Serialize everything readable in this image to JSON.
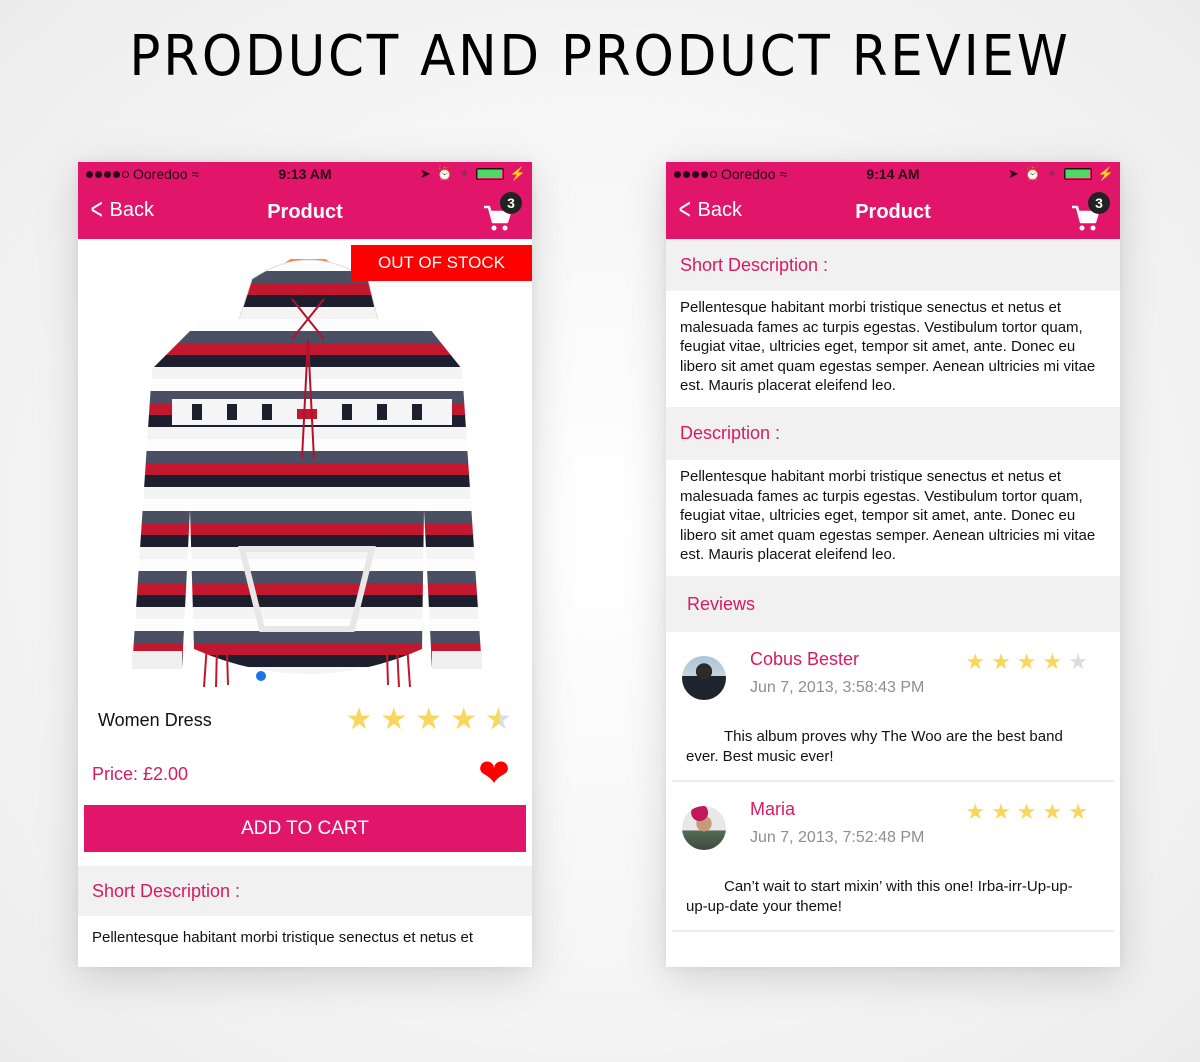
{
  "page": {
    "title": "PRODUCT AND PRODUCT REVIEW"
  },
  "colors": {
    "brand": "#e1166b",
    "accent_text": "#d81b60",
    "out_of_stock": "#ff0000",
    "star_on": "#f9d65d",
    "star_off": "#dcdcdc",
    "heart": "#ff0000"
  },
  "screens": [
    {
      "status": {
        "carrier": "Ooredoo",
        "time": "9:13 AM",
        "signal_bars": 4,
        "signal_total": 5
      },
      "nav": {
        "back_label": "Back",
        "title": "Product",
        "cart_count": "3"
      },
      "product": {
        "badge": "OUT OF STOCK",
        "name": "Women Dress",
        "rating": 4.5,
        "rating_max": 5,
        "price": "Price: £2.00",
        "favorite": true,
        "add_to_cart_label": "ADD TO CART",
        "image_icon": "sweater-image",
        "carousel_page": 1
      },
      "short_description": {
        "header": "Short Description :",
        "text": "Pellentesque habitant morbi tristique senectus et netus et"
      }
    },
    {
      "status": {
        "carrier": "Ooredoo",
        "time": "9:14 AM",
        "signal_bars": 4,
        "signal_total": 5
      },
      "nav": {
        "back_label": "Back",
        "title": "Product",
        "cart_count": "3"
      },
      "short_description": {
        "header": "Short Description :",
        "text": "Pellentesque habitant morbi tristique senectus et netus et malesuada fames ac turpis egestas. Vestibulum tortor quam, feugiat vitae, ultricies eget, tempor sit amet, ante. Donec eu libero sit amet quam egestas semper. Aenean ultricies mi vitae est. Mauris placerat eleifend leo."
      },
      "description": {
        "header": "Description :",
        "text": "Pellentesque habitant morbi tristique senectus et netus et malesuada fames ac turpis egestas. Vestibulum tortor quam, feugiat vitae, ultricies eget, tempor sit amet, ante. Donec eu libero sit amet quam egestas semper. Aenean ultricies mi vitae est. Mauris placerat eleifend leo."
      },
      "reviews": {
        "header": "Reviews",
        "items": [
          {
            "name": "Cobus Bester",
            "date": "Jun 7, 2013, 3:58:43 PM",
            "rating": 4,
            "text": "This album proves why The Woo are the best band ever. Best music ever!"
          },
          {
            "name": "Maria",
            "date": "Jun 7, 2013, 7:52:48 PM",
            "rating": 5,
            "text": "Can’t wait to start mixin’ with this one! Irba-irr-Up-up-up-up-date your theme!"
          }
        ]
      }
    }
  ]
}
